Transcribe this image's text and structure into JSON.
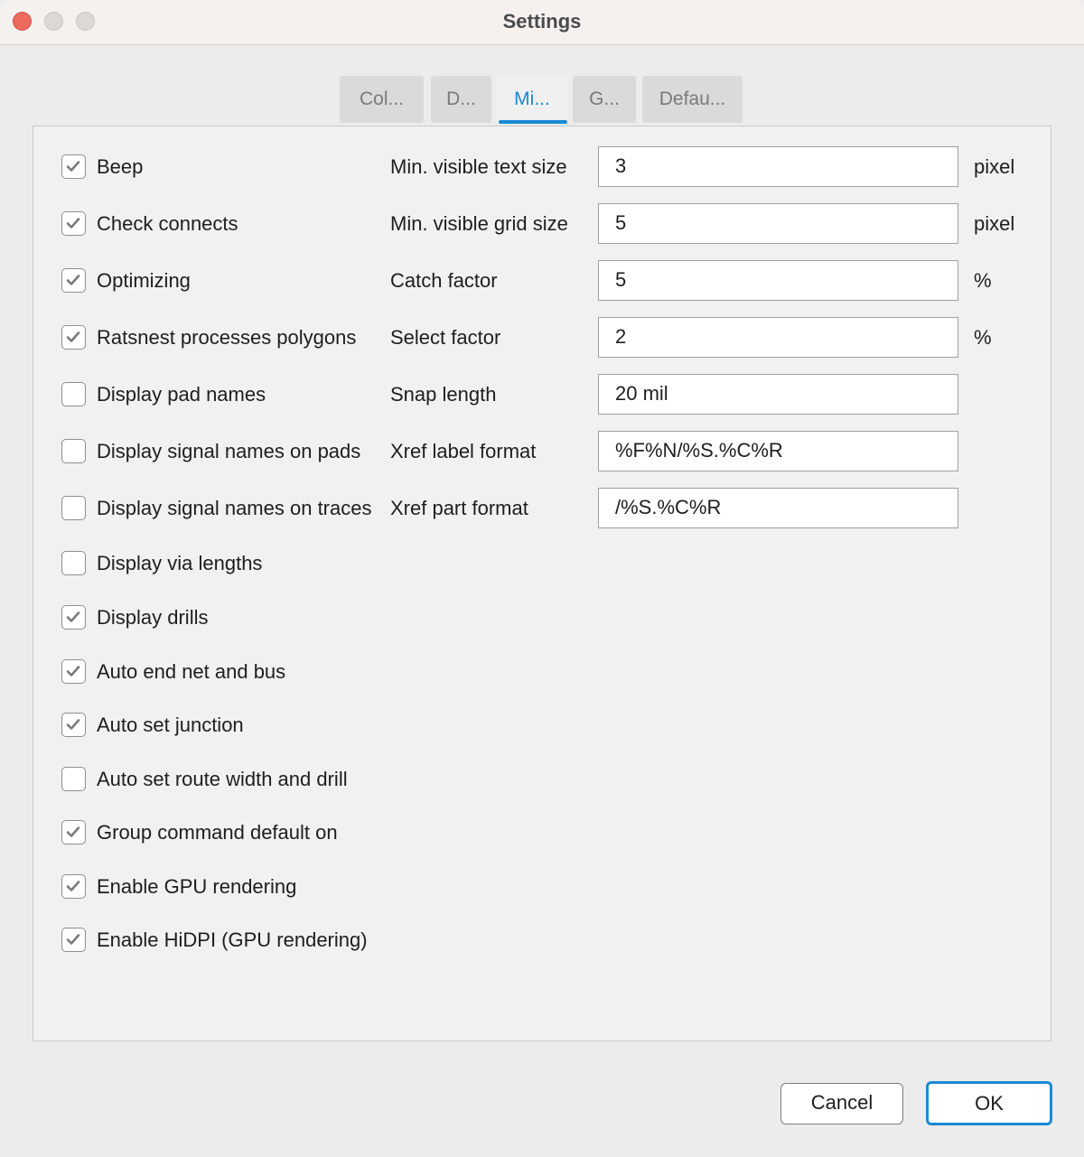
{
  "window": {
    "title": "Settings"
  },
  "tabs": [
    {
      "label": "Col...",
      "active": false
    },
    {
      "label": "D...",
      "active": false
    },
    {
      "label": "Mi...",
      "active": true
    },
    {
      "label": "G...",
      "active": false
    },
    {
      "label": "Defau...",
      "active": false
    }
  ],
  "checkboxes": [
    {
      "label": "Beep",
      "checked": true
    },
    {
      "label": "Check connects",
      "checked": true
    },
    {
      "label": "Optimizing",
      "checked": true
    },
    {
      "label": "Ratsnest processes polygons",
      "checked": true
    },
    {
      "label": "Display pad names",
      "checked": false
    },
    {
      "label": "Display signal names on pads",
      "checked": false
    },
    {
      "label": "Display signal names on traces",
      "checked": false
    },
    {
      "label": "Display via lengths",
      "checked": false
    },
    {
      "label": "Display drills",
      "checked": true
    },
    {
      "label": "Auto end net and bus",
      "checked": true
    },
    {
      "label": "Auto set junction",
      "checked": true
    },
    {
      "label": "Auto set route width and drill",
      "checked": false
    },
    {
      "label": "Group command default on",
      "checked": true
    },
    {
      "label": "Enable GPU rendering",
      "checked": true
    },
    {
      "label": "Enable HiDPI (GPU rendering)",
      "checked": true
    }
  ],
  "fields": [
    {
      "label": "Min. visible text size",
      "value": "3",
      "unit": "pixel"
    },
    {
      "label": "Min. visible grid size",
      "value": "5",
      "unit": "pixel"
    },
    {
      "label": "Catch factor",
      "value": "5",
      "unit": "%"
    },
    {
      "label": "Select factor",
      "value": "2",
      "unit": "%"
    },
    {
      "label": "Snap length",
      "value": "20 mil",
      "unit": ""
    },
    {
      "label": "Xref label format",
      "value": "%F%N/%S.%C%R",
      "unit": ""
    },
    {
      "label": "Xref part format",
      "value": "/%S.%C%R",
      "unit": ""
    }
  ],
  "buttons": {
    "cancel": "Cancel",
    "ok": "OK"
  },
  "colors": {
    "accent": "#1a8ad4",
    "close": "#ed6a5e"
  }
}
